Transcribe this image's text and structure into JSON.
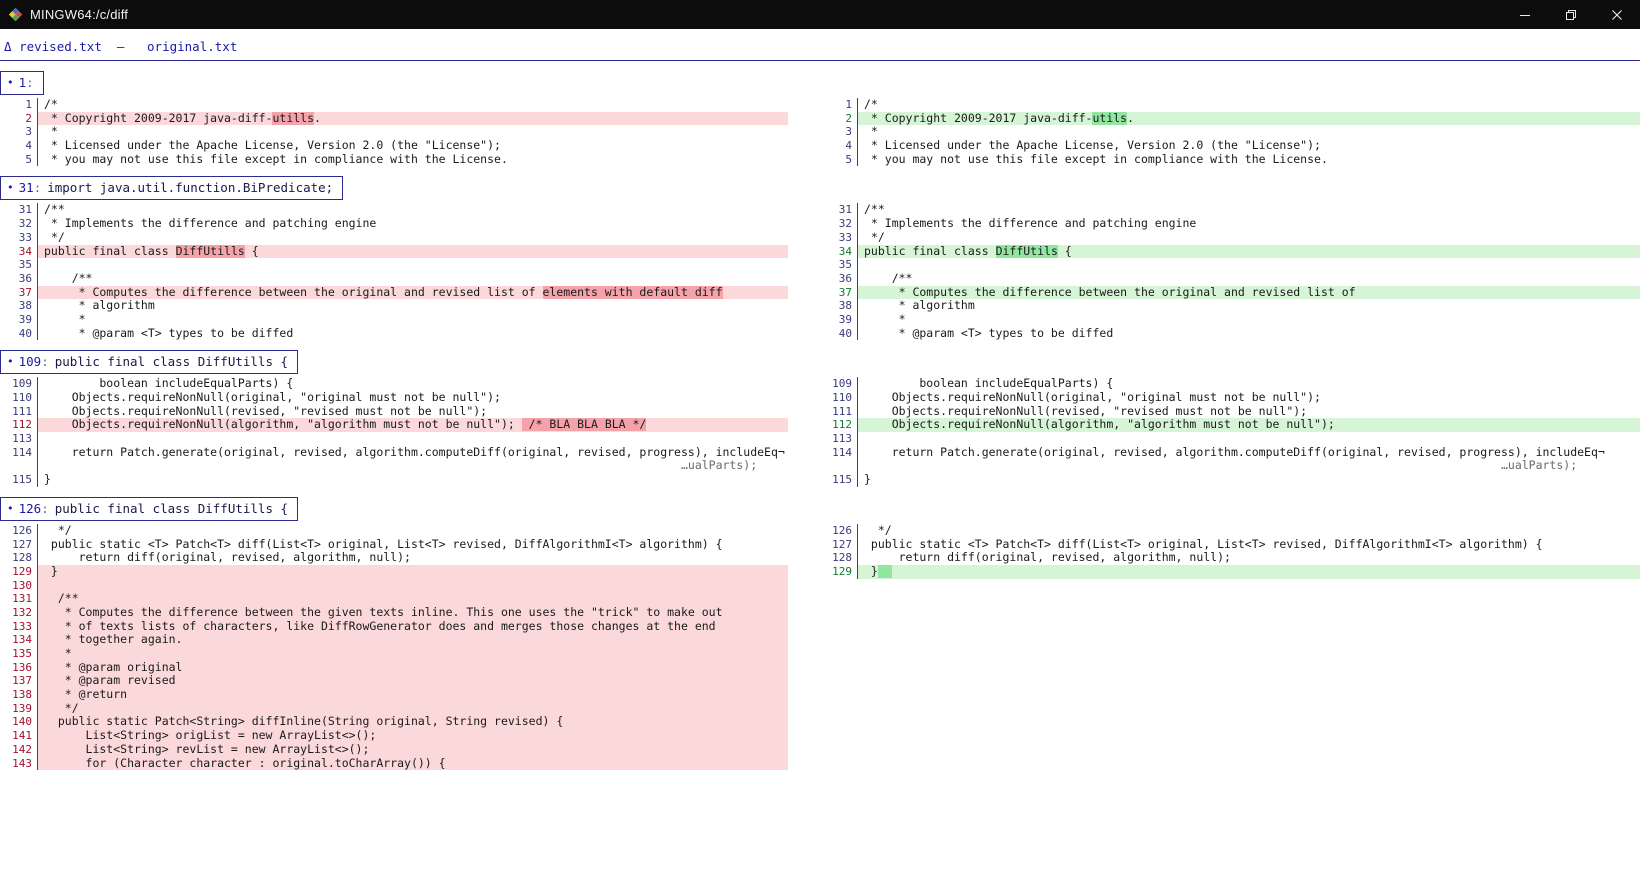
{
  "window": {
    "title": "MINGW64:/c/diff",
    "icon": "mingw-logo-icon",
    "buttons": {
      "minimize": "minimize-icon",
      "maximize": "restore-icon",
      "close": "close-icon"
    }
  },
  "fileheader": {
    "delta_symbol": "Δ",
    "left_file": "revised.txt",
    "separator": "—",
    "right_file": "original.txt"
  },
  "hunks": [
    {
      "bullet": "•",
      "number": "1",
      "colon": ":",
      "context": "",
      "left": [
        {
          "n": "1",
          "type": "ctx",
          "text": "/*"
        },
        {
          "n": "2",
          "type": "del",
          "pre": " * Copyright 2009-2017 java-diff-",
          "word": "utills",
          "post": "."
        },
        {
          "n": "3",
          "type": "ctx",
          "text": " *"
        },
        {
          "n": "4",
          "type": "ctx",
          "text": " * Licensed under the Apache License, Version 2.0 (the \"License\");"
        },
        {
          "n": "5",
          "type": "ctx",
          "text": " * you may not use this file except in compliance with the License."
        }
      ],
      "right": [
        {
          "n": "1",
          "type": "ctx",
          "text": "/*"
        },
        {
          "n": "2",
          "type": "add",
          "pre": " * Copyright 2009-2017 java-diff-",
          "word": "utils",
          "post": "."
        },
        {
          "n": "3",
          "type": "ctx",
          "text": " *"
        },
        {
          "n": "4",
          "type": "ctx",
          "text": " * Licensed under the Apache License, Version 2.0 (the \"License\");"
        },
        {
          "n": "5",
          "type": "ctx",
          "text": " * you may not use this file except in compliance with the License."
        }
      ]
    },
    {
      "bullet": "•",
      "number": "31",
      "colon": ":",
      "context": "import java.util.function.BiPredicate;",
      "left": [
        {
          "n": "31",
          "type": "ctx",
          "text": "/**"
        },
        {
          "n": "32",
          "type": "ctx",
          "text": " * Implements the difference and patching engine"
        },
        {
          "n": "33",
          "type": "ctx",
          "text": " */"
        },
        {
          "n": "34",
          "type": "del",
          "pre": "public final class ",
          "word": "DiffUtills",
          "post": " {"
        },
        {
          "n": "35",
          "type": "ctx",
          "text": ""
        },
        {
          "n": "36",
          "type": "ctx",
          "text": "    /**"
        },
        {
          "n": "37",
          "type": "del",
          "pre": "     * Computes the difference between the original and revised list of ",
          "word": "elements with default diff",
          "post": ""
        },
        {
          "n": "38",
          "type": "ctx",
          "text": "     * algorithm"
        },
        {
          "n": "39",
          "type": "ctx",
          "text": "     *"
        },
        {
          "n": "40",
          "type": "ctx",
          "text": "     * @param <T> types to be diffed"
        }
      ],
      "right": [
        {
          "n": "31",
          "type": "ctx",
          "text": "/**"
        },
        {
          "n": "32",
          "type": "ctx",
          "text": " * Implements the difference and patching engine"
        },
        {
          "n": "33",
          "type": "ctx",
          "text": " */"
        },
        {
          "n": "34",
          "type": "add",
          "pre": "public final class ",
          "word": "DiffUtils",
          "post": " {"
        },
        {
          "n": "35",
          "type": "ctx",
          "text": ""
        },
        {
          "n": "36",
          "type": "ctx",
          "text": "    /**"
        },
        {
          "n": "37",
          "type": "add",
          "pre": "     * Computes the difference between the original and revised list of",
          "word": "",
          "post": ""
        },
        {
          "n": "38",
          "type": "ctx",
          "text": "     * algorithm"
        },
        {
          "n": "39",
          "type": "ctx",
          "text": "     *"
        },
        {
          "n": "40",
          "type": "ctx",
          "text": "     * @param <T> types to be diffed"
        }
      ]
    },
    {
      "bullet": "•",
      "number": "109",
      "colon": ":",
      "context": "public final class DiffUtills {",
      "left": [
        {
          "n": "109",
          "type": "ctx",
          "text": "        boolean includeEqualParts) {"
        },
        {
          "n": "110",
          "type": "ctx",
          "text": "    Objects.requireNonNull(original, \"original must not be null\");"
        },
        {
          "n": "111",
          "type": "ctx",
          "text": "    Objects.requireNonNull(revised, \"revised must not be null\");"
        },
        {
          "n": "112",
          "type": "del",
          "pre": "    Objects.requireNonNull(algorithm, \"algorithm must not be null\"); ",
          "word": " /* BLA BLA BLA */",
          "post": ""
        },
        {
          "n": "113",
          "type": "ctx",
          "text": ""
        },
        {
          "n": "114",
          "type": "ctx",
          "text": "    return Patch.generate(original, revised, algorithm.computeDiff(original, revised, progress), includeEq¬"
        },
        {
          "n": "",
          "type": "wrap",
          "text": "                                                                                            …ualParts);"
        },
        {
          "n": "115",
          "type": "ctx",
          "text": "}"
        }
      ],
      "right": [
        {
          "n": "109",
          "type": "ctx",
          "text": "        boolean includeEqualParts) {"
        },
        {
          "n": "110",
          "type": "ctx",
          "text": "    Objects.requireNonNull(original, \"original must not be null\");"
        },
        {
          "n": "111",
          "type": "ctx",
          "text": "    Objects.requireNonNull(revised, \"revised must not be null\");"
        },
        {
          "n": "112",
          "type": "add",
          "pre": "    Objects.requireNonNull(algorithm, \"algorithm must not be null\");",
          "word": "",
          "post": ""
        },
        {
          "n": "113",
          "type": "ctx",
          "text": ""
        },
        {
          "n": "114",
          "type": "ctx",
          "text": "    return Patch.generate(original, revised, algorithm.computeDiff(original, revised, progress), includeEq¬"
        },
        {
          "n": "",
          "type": "wrap",
          "text": "                                                                                            …ualParts);"
        },
        {
          "n": "115",
          "type": "ctx",
          "text": "}"
        }
      ]
    },
    {
      "bullet": "•",
      "number": "126",
      "colon": ":",
      "context": "public final class DiffUtills {",
      "left": [
        {
          "n": "126",
          "type": "ctx",
          "text": "  */"
        },
        {
          "n": "127",
          "type": "ctx",
          "text": " public static <T> Patch<T> diff(List<T> original, List<T> revised, DiffAlgorithmI<T> algorithm) {"
        },
        {
          "n": "128",
          "type": "ctx",
          "text": "     return diff(original, revised, algorithm, null);"
        },
        {
          "n": "129",
          "type": "del",
          "pre": " }",
          "word": "",
          "post": ""
        },
        {
          "n": "130",
          "type": "del",
          "pre": "",
          "word": "",
          "post": ""
        },
        {
          "n": "131",
          "type": "del",
          "pre": "  /**",
          "word": "",
          "post": ""
        },
        {
          "n": "132",
          "type": "del",
          "pre": "   * Computes the difference between the given texts inline. This one uses the \"trick\" to make out",
          "word": "",
          "post": ""
        },
        {
          "n": "133",
          "type": "del",
          "pre": "   * of texts lists of characters, like DiffRowGenerator does and merges those changes at the end",
          "word": "",
          "post": ""
        },
        {
          "n": "134",
          "type": "del",
          "pre": "   * together again.",
          "word": "",
          "post": ""
        },
        {
          "n": "135",
          "type": "del",
          "pre": "   *",
          "word": "",
          "post": ""
        },
        {
          "n": "136",
          "type": "del",
          "pre": "   * @param original",
          "word": "",
          "post": ""
        },
        {
          "n": "137",
          "type": "del",
          "pre": "   * @param revised",
          "word": "",
          "post": ""
        },
        {
          "n": "138",
          "type": "del",
          "pre": "   * @return",
          "word": "",
          "post": ""
        },
        {
          "n": "139",
          "type": "del",
          "pre": "   */",
          "word": "",
          "post": ""
        },
        {
          "n": "140",
          "type": "del",
          "pre": "  public static Patch<String> diffInline(String original, String revised) {",
          "word": "",
          "post": ""
        },
        {
          "n": "141",
          "type": "del",
          "pre": "      List<String> origList = new ArrayList<>();",
          "word": "",
          "post": ""
        },
        {
          "n": "142",
          "type": "del",
          "pre": "      List<String> revList = new ArrayList<>();",
          "word": "",
          "post": ""
        },
        {
          "n": "143",
          "type": "del",
          "pre": "      for (Character character : original.toCharArray()) {",
          "word": "",
          "post": ""
        }
      ],
      "right": [
        {
          "n": "126",
          "type": "ctx",
          "text": "  */"
        },
        {
          "n": "127",
          "type": "ctx",
          "text": " public static <T> Patch<T> diff(List<T> original, List<T> revised, DiffAlgorithmI<T> algorithm) {"
        },
        {
          "n": "128",
          "type": "ctx",
          "text": "     return diff(original, revised, algorithm, null);"
        },
        {
          "n": "129",
          "type": "add",
          "pre": " }",
          "word": "  ",
          "post": ""
        }
      ]
    }
  ],
  "colors": {
    "titlebar_bg": "#0c0c0c",
    "page_bg": "#ffffff",
    "del_line_bg": "#fbd8da",
    "add_line_bg": "#d6f5d6",
    "del_word_bg": "#f5a3aa",
    "add_word_bg": "#91e6a0",
    "accent_blue": "#1a1aa8",
    "gutter_rule": "#3b3b9b",
    "del_number": "#a01030",
    "add_number": "#0f7a2e"
  }
}
